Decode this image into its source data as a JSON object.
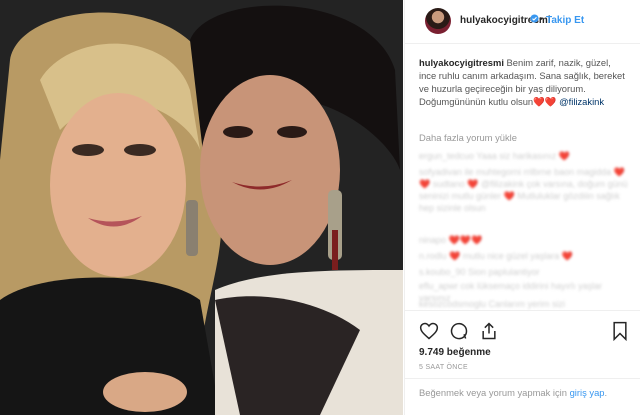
{
  "header": {
    "username": "hulyakocyigitresmi",
    "verified_icon": "verified-badge-icon",
    "separator": "•",
    "follow_label": "Takip Et"
  },
  "caption": {
    "username": "hulyakocyigitresmi",
    "text": "Benim zarif, nazik, güzel, ince ruhlu canım arkadaşım. Sana sağlık, bereket ve huzurla geçireceğin bir yaş diliyorum. Doğumgününün kutlu olsun",
    "emoji": "❤️❤️",
    "mention": "@filizakink"
  },
  "load_more": "Daha fazla yorum yükle",
  "comments": [
    "ergun_tedcuo Yaaa siz harikasınız ❤️",
    "sofyadivan ile muhtegorni rrilbrne baon magidda ❤️❤️ sudtano ❤️ @filizakink çok varsına, doğum günü seninizi mutlu günler ❤️ Mutluluklar gözdiiin sağlık hep sizinle olsun",
    "ninapo ❤️❤️❤️",
    "n.rodlu ❤️ mutlu nice güzel yaşlara ❤️",
    "s.koubo_90 Sion paplulantiyor",
    "eflu_apwr cok lüksemaço iddirini hayırlı yaşlar varsınız",
    "kesozcodsmoglu Canlarım yerim sizi"
  ],
  "actions": {
    "like_icon": "heart-icon",
    "comment_icon": "comment-icon",
    "share_icon": "share-icon",
    "save_icon": "bookmark-icon"
  },
  "likes": "9.749 beğenme",
  "timestamp": "5 SAAT ÖNCE",
  "login": {
    "prompt": "Beğenmek veya yorum yapmak için",
    "link": "giriş yap",
    "period": "."
  }
}
